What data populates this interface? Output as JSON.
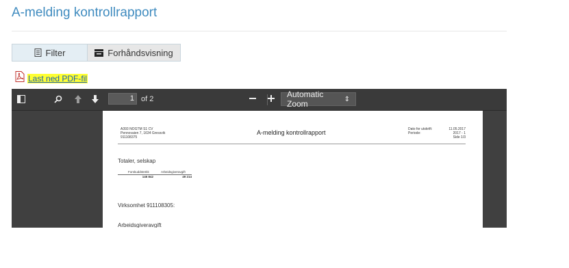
{
  "page": {
    "title": "A-melding kontrollrapport"
  },
  "tabs": [
    {
      "label": "Filter",
      "icon": "document-icon"
    },
    {
      "label": "Forhåndsvisning",
      "icon": "print-preview-icon"
    }
  ],
  "download": {
    "label": "Last ned PDF-fil",
    "icon": "pdf-icon"
  },
  "viewer": {
    "page_number": "1",
    "page_of": "of 2",
    "zoom": "Automatic Zoom",
    "zoom_caret": "⇕"
  },
  "document": {
    "company_line1": "A393 NOGTM S1 CV",
    "company_line2": "Pennovaien 7, 1634 Gressvik",
    "company_line3": "911108375",
    "title": "A-melding kontrollrapport",
    "meta_label1": "Dato for utskrift:",
    "meta_label2": "Periode:",
    "meta_value1": "11.05.2017",
    "meta_value2": "2017 - 1",
    "meta_value3": "Side 1/3",
    "section1": "Totaler, selskap",
    "col1_header": "Forskuddstrekk",
    "col2_header": "Arbeidsgiveravgift",
    "col1_value": "146 842",
    "col2_value": "49 214",
    "section2": "Virksomhet 911108305:",
    "section3": "Arbeidsgiveravgift"
  }
}
